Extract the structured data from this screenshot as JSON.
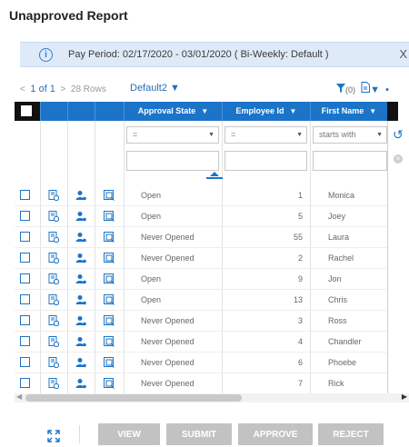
{
  "page": {
    "title": "Unapproved Report"
  },
  "info_bar": {
    "text": "Pay Period: 02/17/2020 - 03/01/2020 ( Bi-Weekly: Default )",
    "close": "X"
  },
  "toolbar": {
    "prev_arrow": "<",
    "page_info": "1 of 1",
    "next_arrow": ">",
    "rows_label": "28 Rows",
    "view_name": "Default2",
    "filter_count": "(0)",
    "more": "•"
  },
  "grid": {
    "columns": [
      {
        "label": "Approval State"
      },
      {
        "label": "Employee Id"
      },
      {
        "label": "First Name"
      }
    ],
    "filters": [
      {
        "operator": "=",
        "value": ""
      },
      {
        "operator": "=",
        "value": ""
      },
      {
        "operator": "starts with",
        "value": ""
      }
    ],
    "rows": [
      {
        "state": "Open",
        "emp_id": "1",
        "first": "Monica"
      },
      {
        "state": "Open",
        "emp_id": "5",
        "first": "Joey"
      },
      {
        "state": "Never Opened",
        "emp_id": "55",
        "first": "Laura"
      },
      {
        "state": "Never Opened",
        "emp_id": "2",
        "first": "Rachel"
      },
      {
        "state": "Open",
        "emp_id": "9",
        "first": "Jon"
      },
      {
        "state": "Open",
        "emp_id": "13",
        "first": "Chris"
      },
      {
        "state": "Never Opened",
        "emp_id": "3",
        "first": "Ross"
      },
      {
        "state": "Never Opened",
        "emp_id": "4",
        "first": "Chandler"
      },
      {
        "state": "Never Opened",
        "emp_id": "6",
        "first": "Phoebe"
      },
      {
        "state": "Never Opened",
        "emp_id": "7",
        "first": "Rick"
      }
    ]
  },
  "actions": {
    "view": "VIEW",
    "submit": "SUBMIT",
    "approve": "APPROVE",
    "reject": "REJECT"
  },
  "colors": {
    "accent": "#1b74c8",
    "info_bg": "#dfeaf8",
    "button_disabled": "#c2c2c2"
  },
  "icons": [
    "info-icon",
    "filter-icon",
    "export-icon",
    "timesheet-icon",
    "person-icon",
    "report-icon",
    "undo-icon",
    "clear-icon",
    "expand-icon"
  ]
}
